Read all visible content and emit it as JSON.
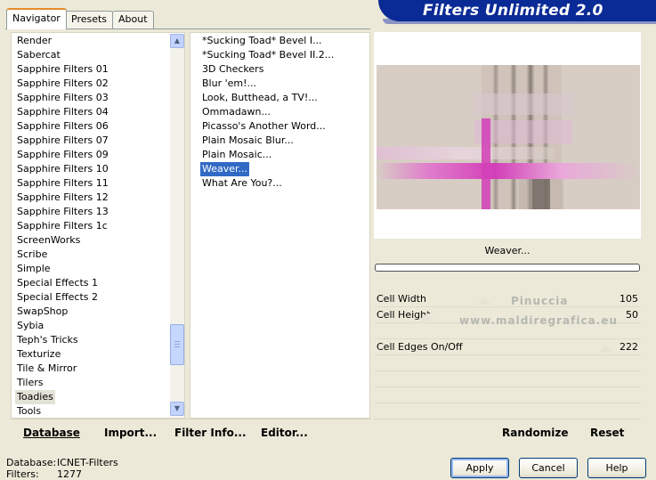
{
  "tabs": [
    "Navigator",
    "Presets",
    "About"
  ],
  "title": "Filters Unlimited 2.0",
  "categories": {
    "items": [
      "Render",
      "Sabercat",
      "Sapphire Filters 01",
      "Sapphire Filters 02",
      "Sapphire Filters 03",
      "Sapphire Filters 04",
      "Sapphire Filters 06",
      "Sapphire Filters 07",
      "Sapphire Filters 09",
      "Sapphire Filters 10",
      "Sapphire Filters 11",
      "Sapphire Filters 12",
      "Sapphire Filters 13",
      "Sapphire Filters 1c",
      "ScreenWorks",
      "Scribe",
      "Simple",
      "Special Effects 1",
      "Special Effects 2",
      "SwapShop",
      "Sybia",
      "Teph's Tricks",
      "Texturize",
      "Tile & Mirror",
      "Tilers",
      "Toadies",
      "Tools"
    ],
    "selected": "Toadies"
  },
  "filters": {
    "items": [
      "*Sucking Toad*  Bevel I...",
      "*Sucking Toad*  Bevel II.2...",
      "3D Checkers",
      "Blur 'em!...",
      "Look, Butthead, a TV!...",
      "Ommadawn...",
      "Picasso's Another Word...",
      "Plain Mosaic Blur...",
      "Plain Mosaic...",
      "Weaver...",
      "What Are You?..."
    ],
    "selected": "Weaver..."
  },
  "bottom_buttons": {
    "database": "Database",
    "import": "Import...",
    "filter_info": "Filter Info...",
    "editor": "Editor...",
    "randomize": "Randomize",
    "reset": "Reset"
  },
  "current_filter": "Weaver...",
  "params": [
    {
      "name": "Cell Width",
      "value": "105"
    },
    {
      "name": "Cell Height",
      "value": "50"
    },
    {
      "name": "Cell Edges On/Off",
      "value": "222"
    }
  ],
  "watermark": [
    "Pinuccia",
    "www.maldiregrafica.eu"
  ],
  "status": {
    "database_label": "Database:",
    "database_value": "ICNET-Filters",
    "filters_label": "Filters:",
    "filters_value": "1277"
  },
  "dialog_buttons": {
    "apply": "Apply",
    "cancel": "Cancel",
    "help": "Help"
  },
  "colors": {
    "title_banner": "#0a2a96",
    "selection": "#316ac5",
    "preview_magenta": "#d23fb8"
  }
}
